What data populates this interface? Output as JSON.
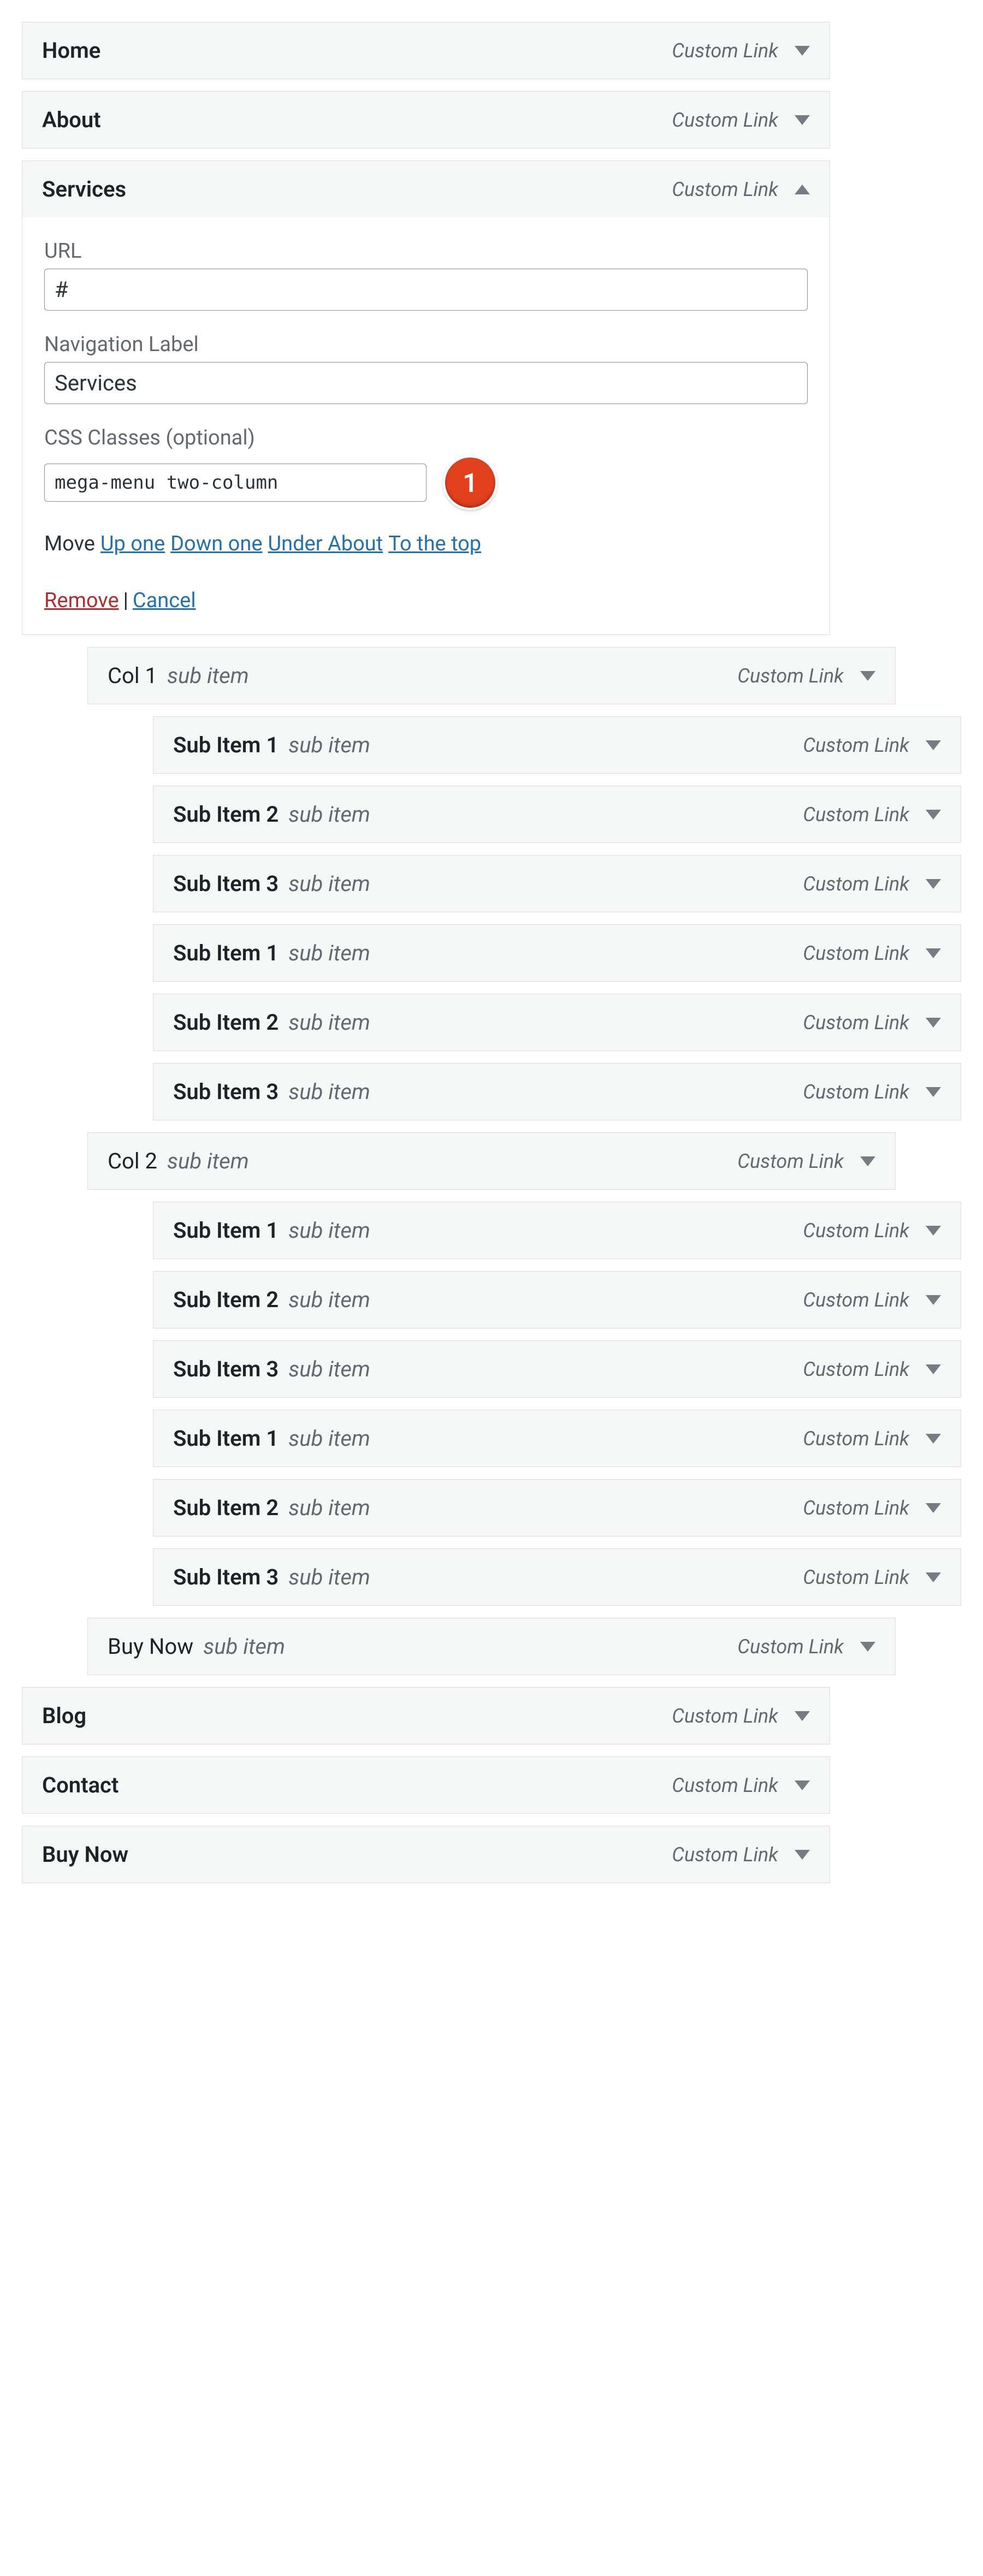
{
  "type_label": "Custom Link",
  "sub_label": "sub item",
  "expanded": {
    "url_label": "URL",
    "url_value": "#",
    "navlabel_label": "Navigation Label",
    "navlabel_value": "Services",
    "css_label": "CSS Classes (optional)",
    "css_value": "mega-menu two-column",
    "marker_text": "1",
    "move_label": "Move",
    "move_up": "Up one",
    "move_down": "Down one",
    "move_under": "Under About",
    "move_top": "To the top",
    "remove": "Remove",
    "cancel": "Cancel",
    "sep": "|"
  },
  "items": [
    {
      "title": "Home",
      "depth": 0,
      "sub": false,
      "expanded": false
    },
    {
      "title": "About",
      "depth": 0,
      "sub": false,
      "expanded": false
    },
    {
      "title": "Services",
      "depth": 0,
      "sub": false,
      "expanded": true
    },
    {
      "title": "Col 1",
      "depth": 1,
      "sub": true,
      "expanded": false
    },
    {
      "title": "Sub Item 1",
      "depth": 2,
      "sub": true,
      "expanded": false
    },
    {
      "title": "Sub Item 2",
      "depth": 2,
      "sub": true,
      "expanded": false
    },
    {
      "title": "Sub Item 3",
      "depth": 2,
      "sub": true,
      "expanded": false
    },
    {
      "title": "Sub Item 1",
      "depth": 2,
      "sub": true,
      "expanded": false
    },
    {
      "title": "Sub Item 2",
      "depth": 2,
      "sub": true,
      "expanded": false
    },
    {
      "title": "Sub Item 3",
      "depth": 2,
      "sub": true,
      "expanded": false
    },
    {
      "title": "Col 2",
      "depth": 1,
      "sub": true,
      "expanded": false
    },
    {
      "title": "Sub Item 1",
      "depth": 2,
      "sub": true,
      "expanded": false
    },
    {
      "title": "Sub Item 2",
      "depth": 2,
      "sub": true,
      "expanded": false
    },
    {
      "title": "Sub Item 3",
      "depth": 2,
      "sub": true,
      "expanded": false
    },
    {
      "title": "Sub Item 1",
      "depth": 2,
      "sub": true,
      "expanded": false
    },
    {
      "title": "Sub Item 2",
      "depth": 2,
      "sub": true,
      "expanded": false
    },
    {
      "title": "Sub Item 3",
      "depth": 2,
      "sub": true,
      "expanded": false
    },
    {
      "title": "Buy Now",
      "depth": 1,
      "sub": true,
      "expanded": false
    },
    {
      "title": "Blog",
      "depth": 0,
      "sub": false,
      "expanded": false
    },
    {
      "title": "Contact",
      "depth": 0,
      "sub": false,
      "expanded": false
    },
    {
      "title": "Buy Now",
      "depth": 0,
      "sub": false,
      "expanded": false
    }
  ]
}
